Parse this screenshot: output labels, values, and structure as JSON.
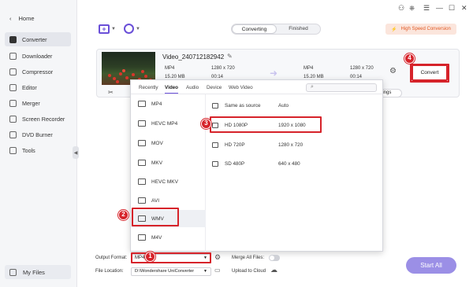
{
  "window": {
    "controls": [
      "⚇",
      "⎈",
      "☰",
      "—",
      "☐",
      "✕"
    ]
  },
  "sidebar": {
    "home_label": "Home",
    "items": [
      {
        "label": "Converter",
        "icon": "converter-icon",
        "active": true
      },
      {
        "label": "Downloader",
        "icon": "downloader-icon"
      },
      {
        "label": "Compressor",
        "icon": "compressor-icon"
      },
      {
        "label": "Editor",
        "icon": "editor-icon"
      },
      {
        "label": "Merger",
        "icon": "merger-icon"
      },
      {
        "label": "Screen Recorder",
        "icon": "screen-recorder-icon"
      },
      {
        "label": "DVD Burner",
        "icon": "dvd-burner-icon"
      },
      {
        "label": "Tools",
        "icon": "tools-icon"
      }
    ],
    "my_files_label": "My Files"
  },
  "header": {
    "tabs": [
      {
        "label": "Converting",
        "active": true
      },
      {
        "label": "Finished",
        "active": false
      }
    ],
    "high_speed_label": "High Speed Conversion",
    "accent_color": "#6a4fd8"
  },
  "file": {
    "name": "Video_240712182942",
    "source": {
      "format": "MP4",
      "resolution": "1280 x 720",
      "size": "15.20 MB",
      "duration": "00:14"
    },
    "target": {
      "format": "MP4",
      "resolution": "1280 x 720",
      "size": "15.20 MB",
      "duration": "00:14"
    },
    "settings_label": "ettings",
    "convert_label": "Convert"
  },
  "popup": {
    "tabs": [
      {
        "label": "Recently",
        "active": false
      },
      {
        "label": "Video",
        "active": true
      },
      {
        "label": "Audio",
        "active": false
      },
      {
        "label": "Device",
        "active": false
      },
      {
        "label": "Web Video",
        "active": false
      }
    ],
    "formats": [
      {
        "label": "MP4",
        "selected": false
      },
      {
        "label": "HEVC MP4",
        "selected": false
      },
      {
        "label": "MOV",
        "selected": false
      },
      {
        "label": "MKV",
        "selected": false
      },
      {
        "label": "HEVC MKV",
        "selected": false
      },
      {
        "label": "AVI",
        "selected": false
      },
      {
        "label": "WMV",
        "selected": true
      },
      {
        "label": "M4V",
        "selected": false
      }
    ],
    "qualities": [
      {
        "name": "Same as source",
        "resolution": "Auto"
      },
      {
        "name": "HD 1080P",
        "resolution": "1920 x 1080"
      },
      {
        "name": "HD 720P",
        "resolution": "1280 x 720"
      },
      {
        "name": "SD 480P",
        "resolution": "640 x 480"
      }
    ]
  },
  "bottom": {
    "output_format_label": "Output Format:",
    "output_format_value": "MP4",
    "merge_label": "Merge All Files:",
    "file_location_label": "File Location:",
    "file_location_value": "D:\\Wondershare UniConverter",
    "upload_label": "Upload to Cloud",
    "start_all_label": "Start All"
  },
  "steps": [
    "1",
    "2",
    "3",
    "4"
  ],
  "highlight_color": "#d6232a"
}
